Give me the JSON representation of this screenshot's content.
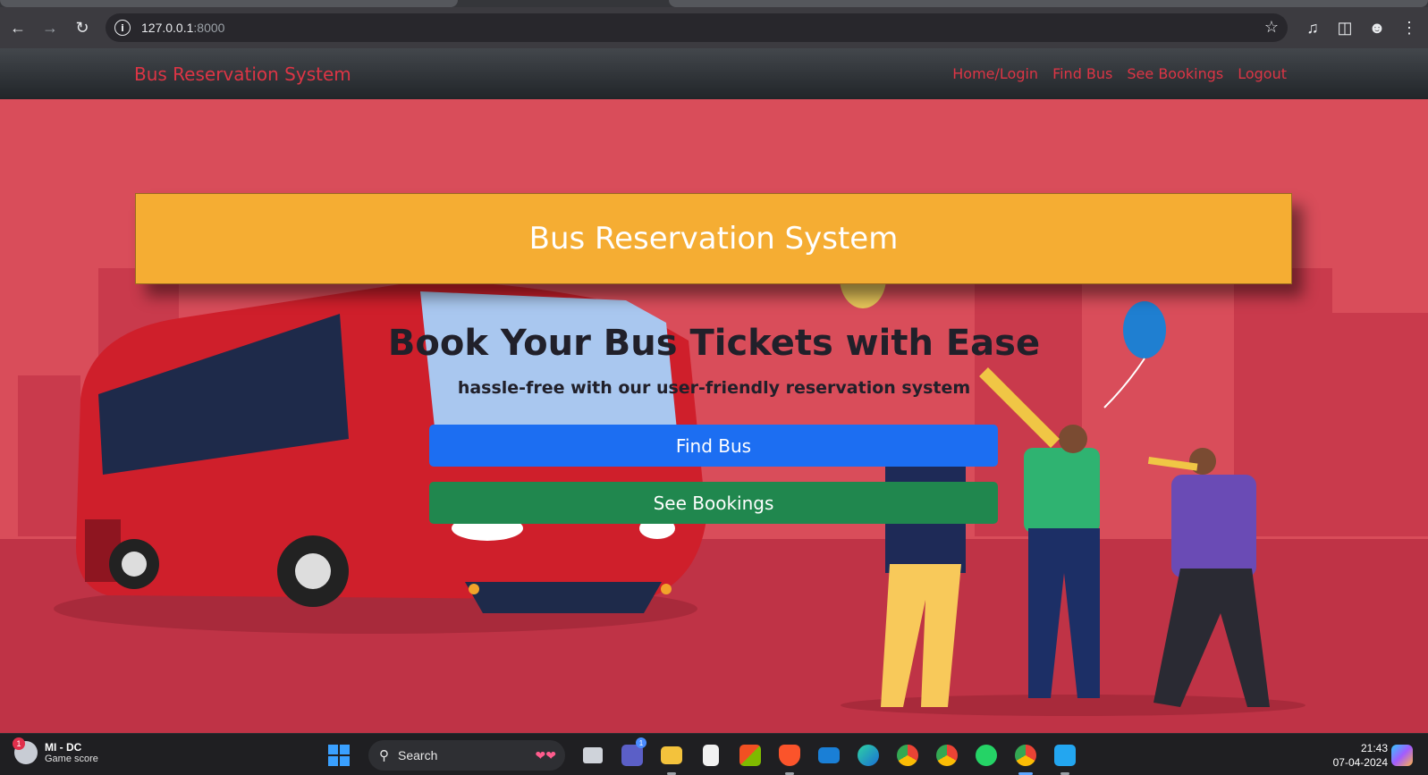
{
  "browser": {
    "url_host": "127.0.0.1",
    "url_port": ":8000"
  },
  "navbar": {
    "brand": "Bus Reservation System",
    "links": [
      "Home/Login",
      "Find Bus",
      "See Bookings",
      "Logout"
    ]
  },
  "hero": {
    "banner_title": "Bus Reservation System",
    "headline": "Book Your Bus Tickets with Ease",
    "subline": "hassle-free with our user-friendly reservation system",
    "find_bus_label": "Find Bus",
    "see_bookings_label": "See Bookings"
  },
  "taskbar": {
    "widget_badge": "1",
    "widget_title": "MI - DC",
    "widget_subtitle": "Game score",
    "search_label": "Search",
    "teams_badge": "1",
    "time": "21:43",
    "date": "07-04-2024"
  },
  "colors": {
    "accent_red": "#dc3545",
    "banner": "#f5ad33",
    "primary": "#1c6ef2",
    "success": "#20874e"
  }
}
